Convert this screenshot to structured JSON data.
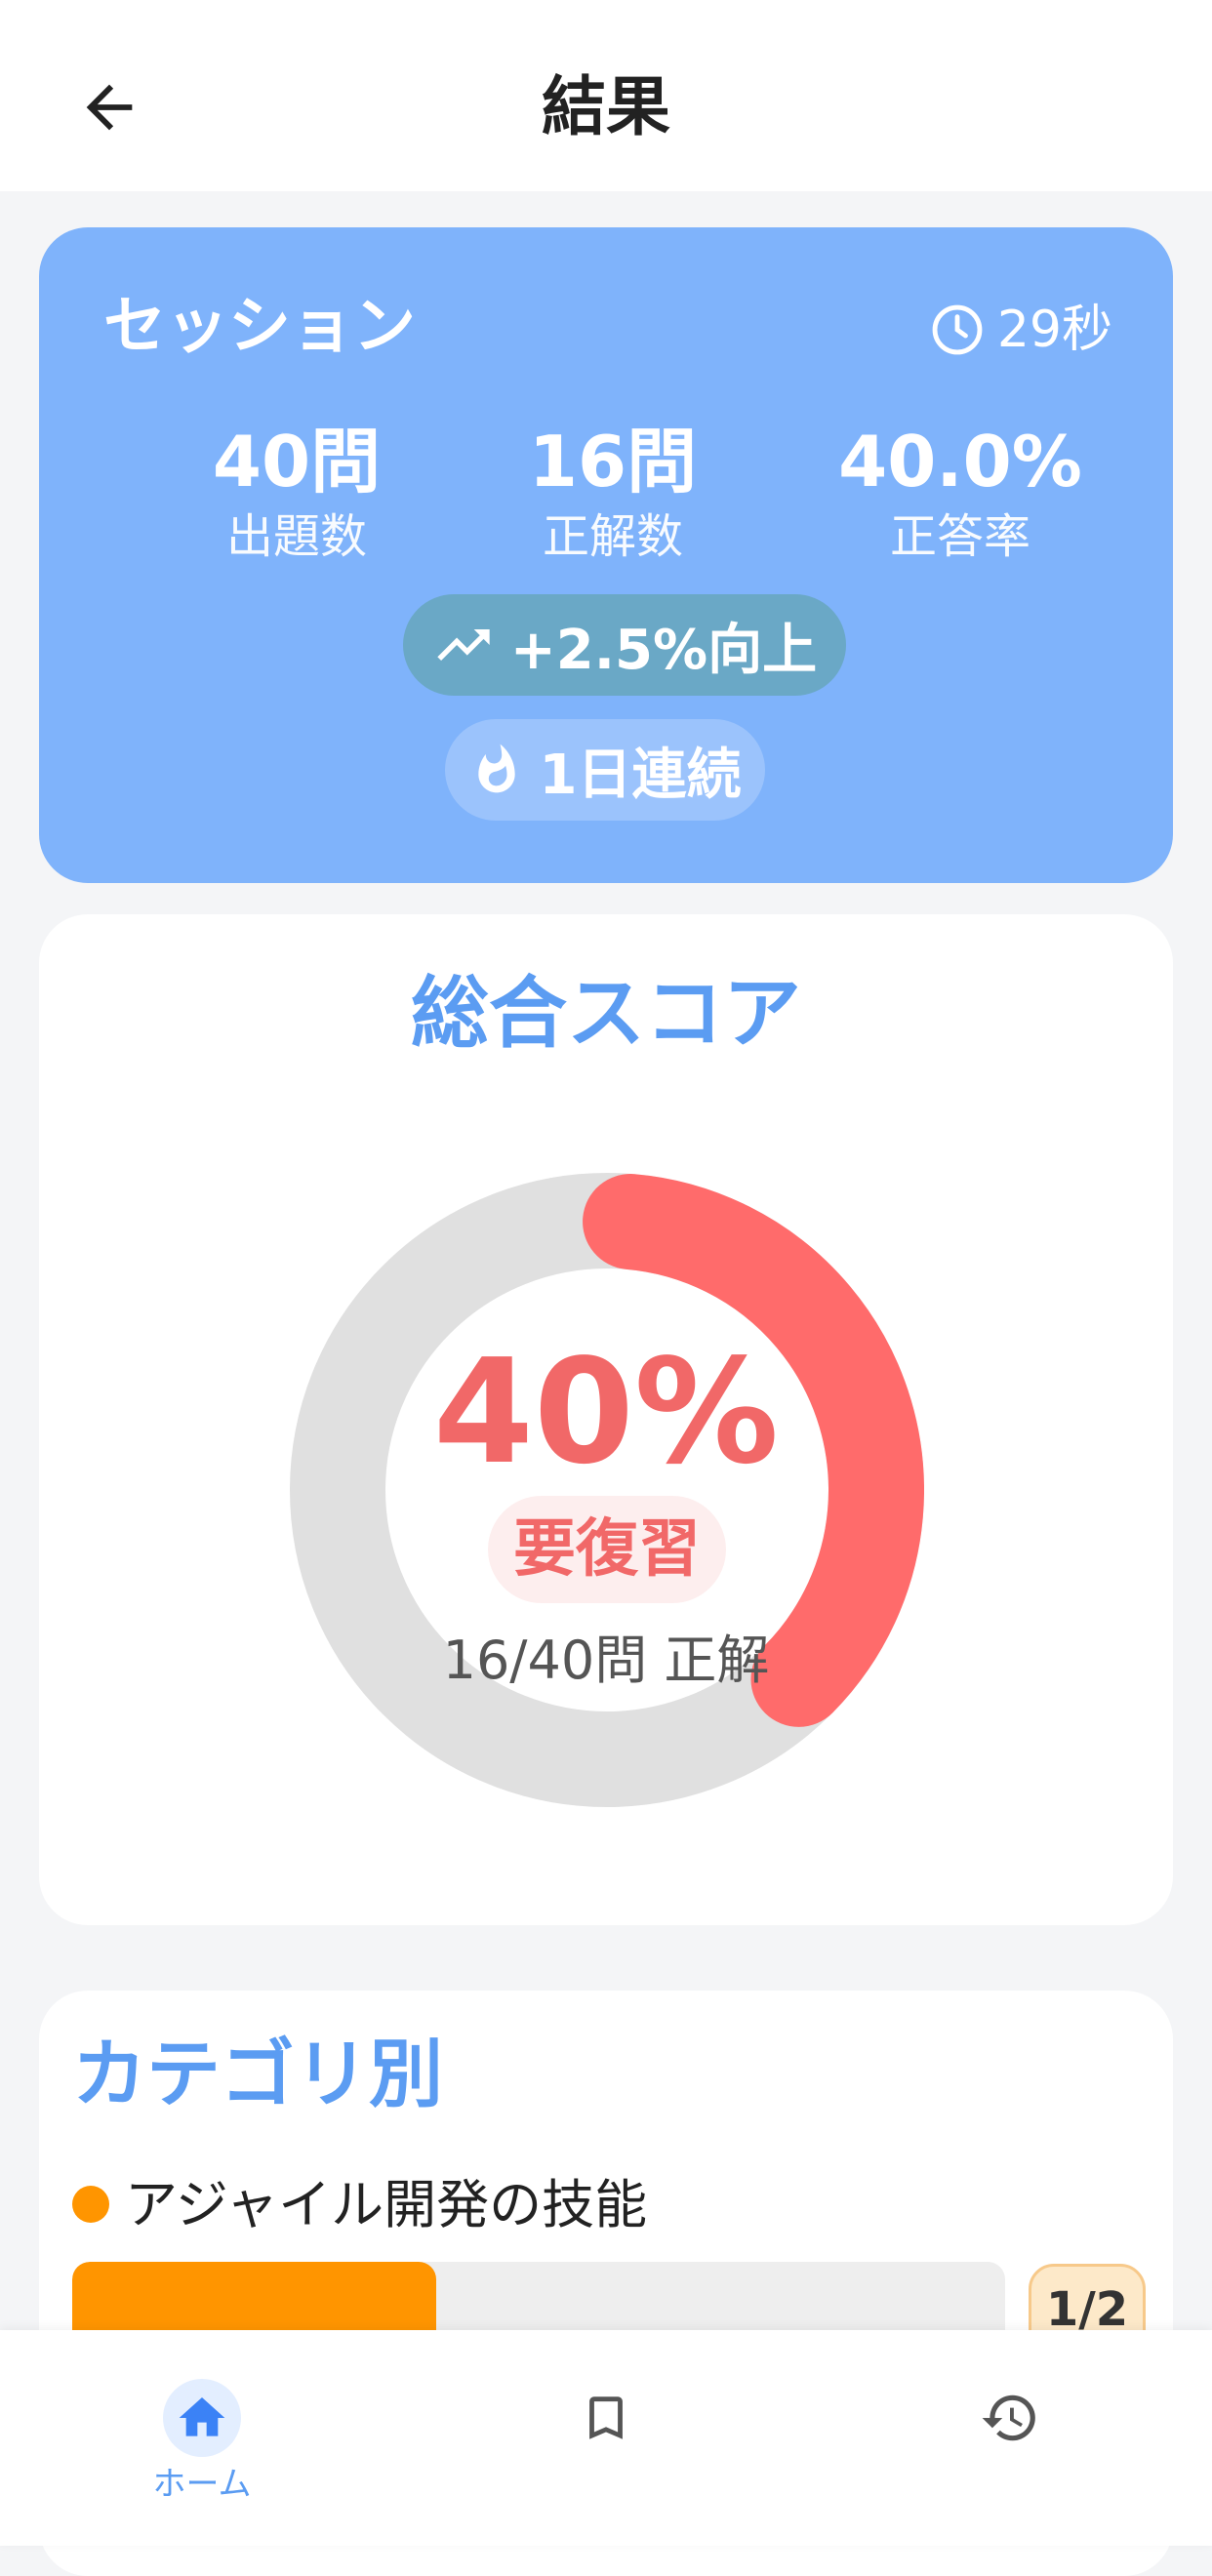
{
  "header": {
    "title": "結果",
    "back_icon": "arrow-left-icon"
  },
  "session": {
    "title": "セッション",
    "time": "29秒",
    "stats": [
      {
        "value": "40問",
        "label": "出題数"
      },
      {
        "value": "16問",
        "label": "正解数"
      },
      {
        "value": "40.0%",
        "label": "正答率"
      }
    ],
    "improvement": "+2.5%向上",
    "streak": "1日連続",
    "colors": {
      "card": "#7fb3fb",
      "improve_pill": "#6aa8c6"
    }
  },
  "score": {
    "title": "総合スコア",
    "percent": "40%",
    "percent_value": 40,
    "status": "要復習",
    "detail": "16/40問 正解",
    "colors": {
      "arc": "#ff6b6b",
      "track": "#e0e0e0"
    }
  },
  "categories": {
    "title": "カテゴリ別",
    "items": [
      {
        "label": "アジャイル開発の技能",
        "count": "1/2",
        "fraction": 0.39,
        "color": "#ff9500"
      }
    ]
  },
  "nav": {
    "home_label": "ホーム",
    "items": [
      "home-icon",
      "bookmark-icon",
      "history-icon"
    ]
  }
}
